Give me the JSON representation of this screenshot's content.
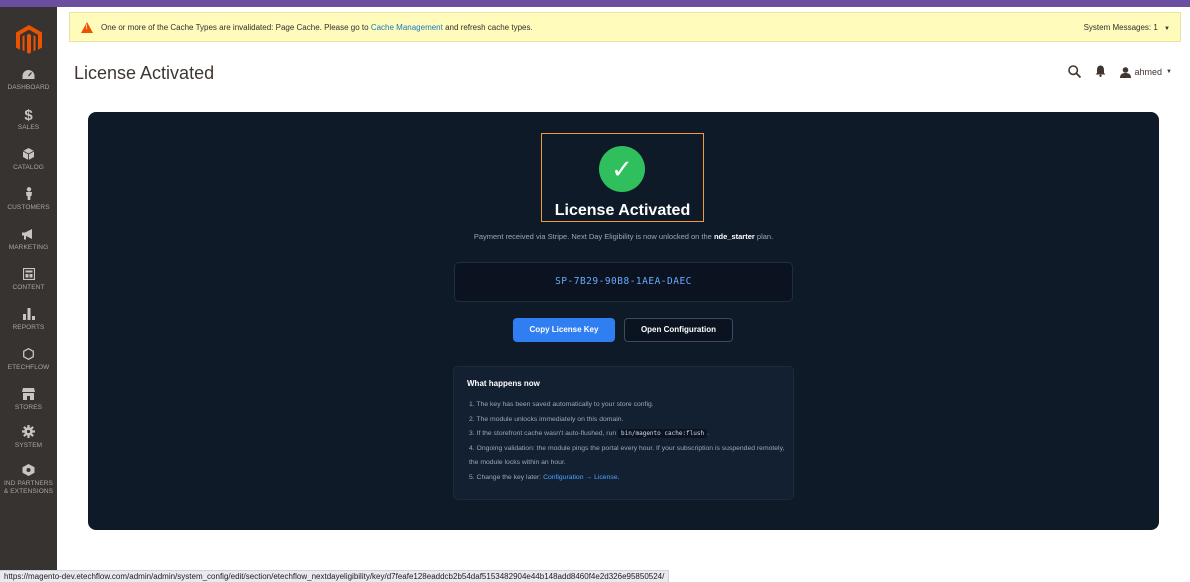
{
  "sidebar": {
    "items": [
      {
        "label": "DASHBOARD",
        "icon": "dashboard-icon"
      },
      {
        "label": "SALES",
        "icon": "dollar-icon"
      },
      {
        "label": "CATALOG",
        "icon": "cube-icon"
      },
      {
        "label": "CUSTOMERS",
        "icon": "person-icon"
      },
      {
        "label": "MARKETING",
        "icon": "megaphone-icon"
      },
      {
        "label": "CONTENT",
        "icon": "layout-icon"
      },
      {
        "label": "REPORTS",
        "icon": "bar-chart-icon"
      },
      {
        "label": "ETECHFLOW",
        "icon": "hexagon-icon"
      },
      {
        "label": "STORES",
        "icon": "store-icon"
      },
      {
        "label": "SYSTEM",
        "icon": "gear-icon"
      },
      {
        "label": "IND PARTNERS",
        "label2": "& EXTENSIONS",
        "icon": "partners-icon"
      }
    ]
  },
  "system_message": {
    "text_before": "One or more of the Cache Types are invalidated: Page Cache. Please go to",
    "link": "Cache Management",
    "text_after": "and refresh cache types.",
    "right_label": "System Messages: 1"
  },
  "header": {
    "title": "License Activated",
    "user": "ahmed"
  },
  "card": {
    "check_glyph": "✓",
    "title": "License Activated",
    "subtext_before": "Payment received via Stripe. Next Day Eligibility is now unlocked on the",
    "plan": "nde_starter",
    "subtext_after": "plan.",
    "license_key": "SP-7B29-90B8-1AEA-DAEC",
    "copy_button": "Copy License Key",
    "open_button": "Open Configuration"
  },
  "what_happens": {
    "title": "What happens now",
    "step1": "1. The key has been saved automatically to your store config.",
    "step2": "2. The module unlocks immediately on this domain.",
    "step3_before": "3. If the storefront cache wasn't auto-flushed, run",
    "step3_code": "bin/magento cache:flush",
    "step3_after": ".",
    "step4": "4. Ongoing validation: the module pings the portal every hour. If your subscription is suspended remotely, the module locks within an hour.",
    "step5_before": "5. Change the key later:",
    "step5_link": "Configuration → License",
    "step5_after": "."
  },
  "status_url": "https://magento-dev.etechflow.com/admin/admin/system_config/edit/section/etechflow_nextdayeligibility/key/d7feafe128eaddcb2b54daf5153482904e44b148add8460f4e2d326e95850524/",
  "colors": {
    "sidebar": "#373330",
    "card": "#0f1a29",
    "accent": "#2f7ff2",
    "success": "#2fbf5d",
    "highlight": "#f39a3b",
    "magento_orange": "#eb5202"
  }
}
